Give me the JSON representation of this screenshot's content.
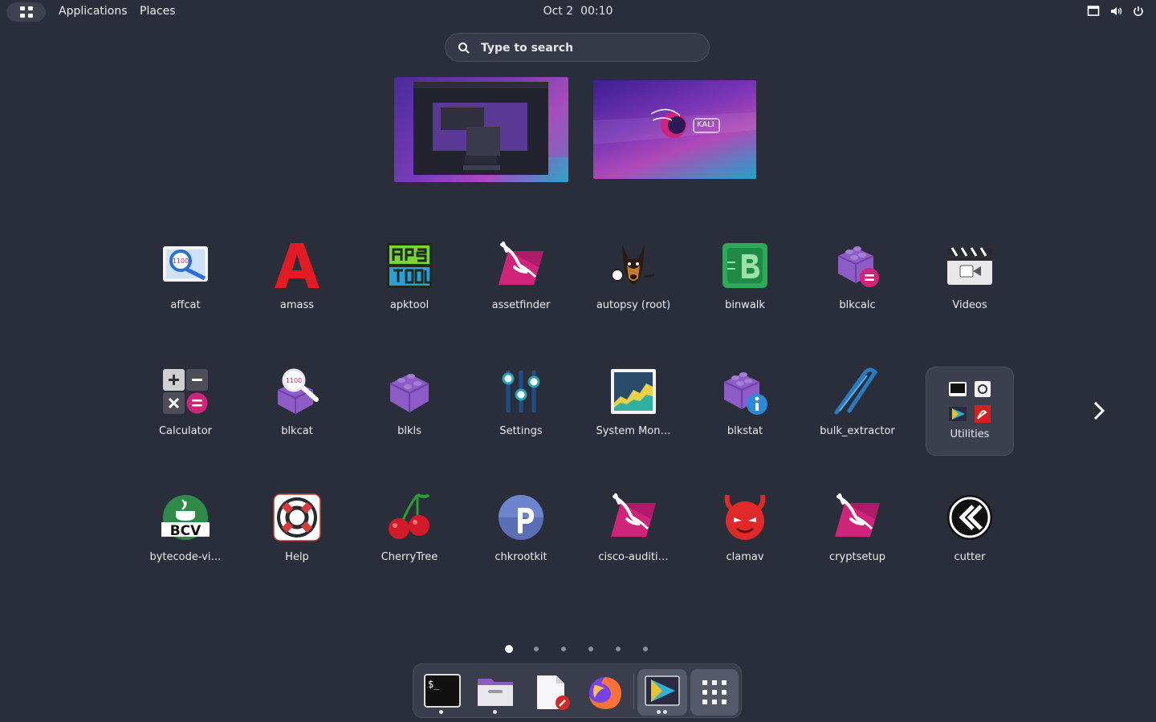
{
  "topbar": {
    "applications_label": "Applications",
    "places_label": "Places",
    "date": "Oct 2",
    "time": "00:10"
  },
  "search": {
    "placeholder": "Type to search"
  },
  "workspaces": [
    {
      "name": "workspace-1"
    },
    {
      "name": "workspace-2",
      "logo_text": "KALI"
    }
  ],
  "apps": [
    {
      "label": "affcat",
      "icon": "magnifier-disk-icon"
    },
    {
      "label": "amass",
      "icon": "red-a-icon"
    },
    {
      "label": "apktool",
      "icon": "apktool-icon"
    },
    {
      "label": "assetfinder",
      "icon": "kali-dragon-icon"
    },
    {
      "label": "autopsy (root)",
      "icon": "dog-icon"
    },
    {
      "label": "binwalk",
      "icon": "binwalk-chip-icon"
    },
    {
      "label": "blkcalc",
      "icon": "lego-calc-icon"
    },
    {
      "label": "Videos",
      "icon": "clapperboard-icon"
    },
    {
      "label": "Calculator",
      "icon": "calculator-icon"
    },
    {
      "label": "blkcat",
      "icon": "lego-magnifier-icon"
    },
    {
      "label": "blkls",
      "icon": "lego-brick-icon"
    },
    {
      "label": "Settings",
      "icon": "sliders-icon"
    },
    {
      "label": "System Mon…",
      "icon": "system-monitor-icon"
    },
    {
      "label": "blkstat",
      "icon": "lego-info-icon"
    },
    {
      "label": "bulk_extractor",
      "icon": "tweezers-icon"
    },
    {
      "label": "Utilities",
      "icon": "folder-icon"
    },
    {
      "label": "bytecode-vi…",
      "icon": "bcv-icon"
    },
    {
      "label": "Help",
      "icon": "lifebuoy-icon"
    },
    {
      "label": "CherryTree",
      "icon": "cherries-icon"
    },
    {
      "label": "chkrootkit",
      "icon": "p-ball-icon"
    },
    {
      "label": "cisco-auditi…",
      "icon": "kali-dragon-icon"
    },
    {
      "label": "clamav",
      "icon": "devil-icon"
    },
    {
      "label": "cryptsetup",
      "icon": "kali-dragon-icon"
    },
    {
      "label": "cutter",
      "icon": "cutter-icon"
    }
  ],
  "pagination": {
    "pages": 6,
    "current": 1
  },
  "dock": [
    {
      "name": "terminal",
      "running": 1,
      "terminal_prompt": "$_"
    },
    {
      "name": "files",
      "running": 1
    },
    {
      "name": "text-editor",
      "running": 0
    },
    {
      "name": "firefox",
      "running": 0
    },
    {
      "name": "software",
      "running": 2,
      "selected": true
    },
    {
      "name": "show-apps",
      "running": 0
    }
  ],
  "colors": {
    "background": "#2a2d3a",
    "kali_pink": "#d0237a",
    "lego_purple": "#8d5cc7"
  }
}
